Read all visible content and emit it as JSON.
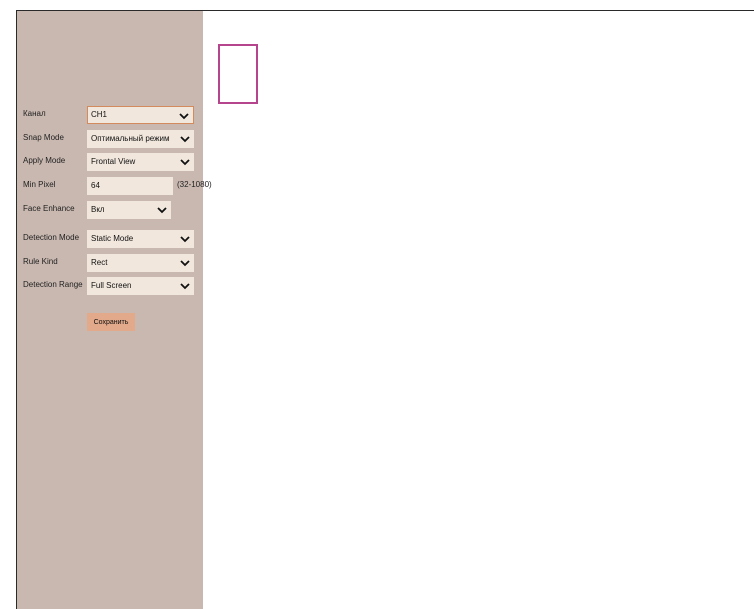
{
  "form": {
    "channel": {
      "label": "Канал",
      "value": "CH1"
    },
    "snap_mode": {
      "label": "Snap Mode",
      "value": "Оптимальный режим"
    },
    "apply_mode": {
      "label": "Apply Mode",
      "value": "Frontal View"
    },
    "min_pixel": {
      "label": "Min Pixel",
      "value": "64",
      "range_hint": "(32-1080)"
    },
    "face_enhance": {
      "label": "Face Enhance",
      "value": "Вкл"
    },
    "detection_mode": {
      "label": "Detection Mode",
      "value": "Static Mode"
    },
    "rule_kind": {
      "label": "Rule Kind",
      "value": "Rect"
    },
    "detection_range": {
      "label": "Detection Range",
      "value": "Full Screen"
    },
    "save_label": "Сохранить"
  },
  "colors": {
    "sidebar_bg": "#c9b8b0",
    "field_bg": "#f1e7dd",
    "save_button": "#e2a98a",
    "detection_rect": "#b5468e"
  }
}
